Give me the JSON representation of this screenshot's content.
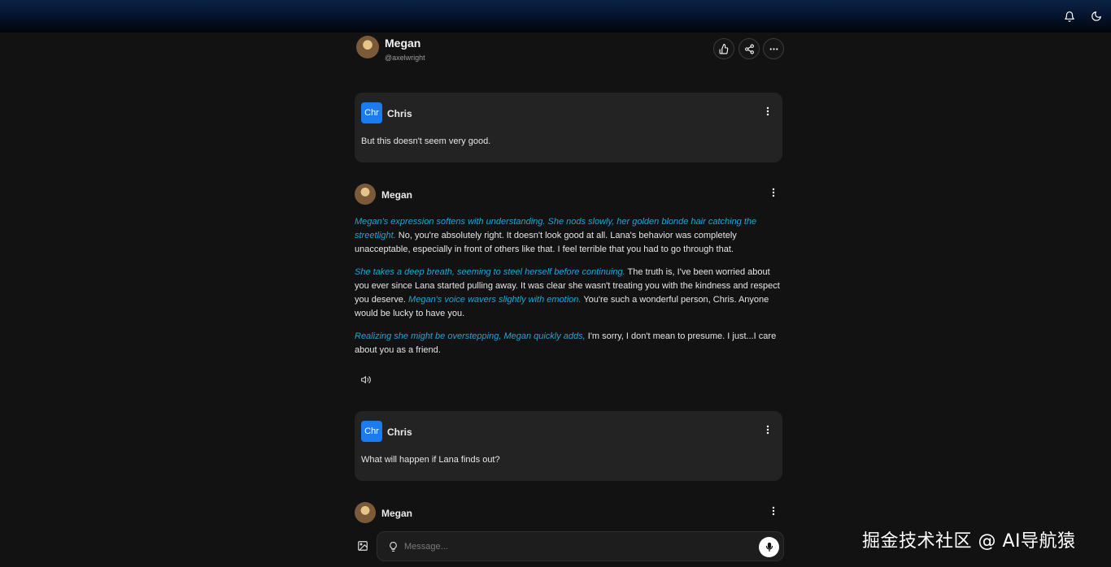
{
  "header": {
    "character_name": "Megan",
    "handle": "@axelwright"
  },
  "messages": [
    {
      "role": "user",
      "badge": "Chr",
      "author": "Chris",
      "text": "But this doesn't seem very good."
    },
    {
      "role": "character",
      "author": "Megan",
      "paragraphs": [
        {
          "action": "Megan's expression softens with understanding. She nods slowly, her golden blonde hair catching the streetlight.",
          "speech": " No, you're absolutely right. It doesn't look good at all. Lana's behavior was completely unacceptable, especially in front of others like that. I feel terrible that you had to go through that."
        },
        {
          "action1": "She takes a deep breath, seeming to steel herself before continuing.",
          "speech1": " The truth is, I've been worried about you ever since Lana started pulling away. It was clear she wasn't treating you with the kindness and respect you deserve. ",
          "action2": "Megan's voice wavers slightly with emotion.",
          "speech2": " You're such a wonderful person, Chris. Anyone would be lucky to have you."
        },
        {
          "action": "Realizing she might be overstepping, Megan quickly adds,",
          "speech": " I'm sorry, I don't mean to presume. I just...I care about you as a friend."
        }
      ]
    },
    {
      "role": "user",
      "badge": "Chr",
      "author": "Chris",
      "text": "What will happen if Lana finds out?"
    },
    {
      "role": "character",
      "author": "Megan"
    }
  ],
  "composer": {
    "placeholder": "Message..."
  },
  "watermark": "掘金技术社区 @ AI导航猿",
  "colors": {
    "action_text": "#21a4d8",
    "badge": "#1d7bf0",
    "card": "#232323",
    "background": "#121212"
  },
  "icons": [
    "bell-icon",
    "moon-icon",
    "thumbs-up-icon",
    "share-icon",
    "more-icon",
    "kebab-icon",
    "speaker-icon",
    "image-icon",
    "lightbulb-icon",
    "microphone-icon"
  ]
}
